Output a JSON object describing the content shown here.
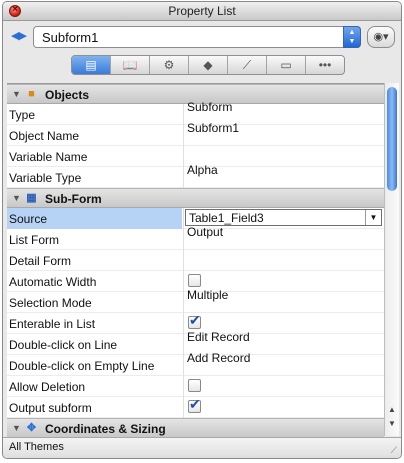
{
  "window": {
    "title": "Property List"
  },
  "object_selector": {
    "value": "Subform1"
  },
  "toolbar": {
    "icons": [
      "form-icon",
      "book-icon",
      "gear-icon",
      "shapes-icon",
      "chart-icon",
      "monitor-icon",
      "more-icon"
    ]
  },
  "sections": {
    "objects": {
      "label": "Objects"
    },
    "subform": {
      "label": "Sub-Form"
    },
    "coords": {
      "label": "Coordinates & Sizing"
    }
  },
  "properties": {
    "type": {
      "name": "Type",
      "value": "Subform"
    },
    "object_name": {
      "name": "Object Name",
      "value": "Subform1"
    },
    "variable_name": {
      "name": "Variable Name",
      "value": ""
    },
    "variable_type": {
      "name": "Variable Type",
      "value": "Alpha"
    },
    "source": {
      "name": "Source",
      "value": "Table1_Field3"
    },
    "list_form": {
      "name": "List Form",
      "value": "Output"
    },
    "detail_form": {
      "name": "Detail Form",
      "value": ""
    },
    "automatic_width": {
      "name": "Automatic Width",
      "checked": false
    },
    "selection_mode": {
      "name": "Selection Mode",
      "value": "Multiple"
    },
    "enterable_in_list": {
      "name": "Enterable in List",
      "checked": true
    },
    "double_click_line": {
      "name": "Double-click on Line",
      "value": "Edit Record"
    },
    "double_click_empty": {
      "name": "Double-click on Empty Line",
      "value": "Add Record"
    },
    "allow_deletion": {
      "name": "Allow Deletion",
      "checked": false
    },
    "output_subform": {
      "name": "Output subform",
      "checked": true
    }
  },
  "status": {
    "text": "All Themes"
  }
}
